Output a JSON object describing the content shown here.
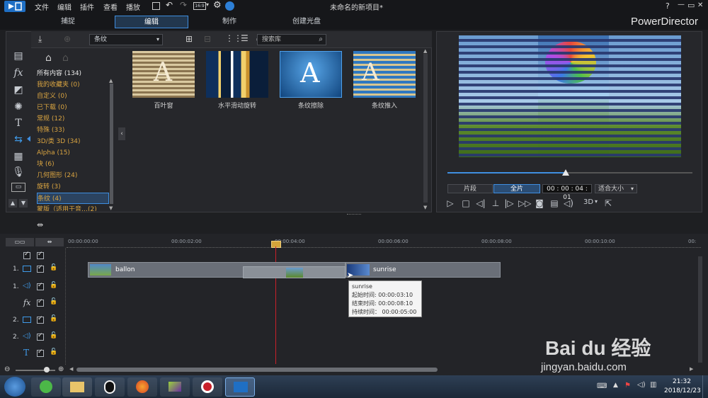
{
  "titlebar": {
    "menu": [
      "文件",
      "编辑",
      "插件",
      "查看",
      "播放"
    ],
    "project_title": "未命名的新项目*",
    "help": "?",
    "minimize": "—",
    "maximize": "▭",
    "close": "✕"
  },
  "modes": {
    "tabs": [
      "捕捉",
      "编辑",
      "制作",
      "创建光盘"
    ],
    "active": "编辑",
    "brand": "PowerDirector"
  },
  "library": {
    "category_select": "条纹",
    "search_placeholder": "搜索库",
    "categories": [
      "所有内容 (134)",
      "我的收藏夹 (0)",
      "自定义 (0)",
      "已下载 (0)",
      "常规 (12)",
      "特殊 (33)",
      "3D/类 3D (34)",
      "Alpha (15)",
      "块 (6)",
      "几何图形 (24)",
      "旋转 (3)",
      "条纹 (4)",
      "蒙版（适用于音…(2)"
    ],
    "selected_category": "条纹 (4)",
    "transitions": [
      "百叶窗",
      "水平滑动旋转",
      "条纹擦除",
      "条纹推入"
    ]
  },
  "preview": {
    "clip_label": "片段",
    "full_label": "全片",
    "timecode": "00 : 00 : 04 : 01",
    "fit": "适合大小",
    "mode_3d": "3D"
  },
  "timeline": {
    "ruler": [
      "00:00:00:00",
      "00:00:02:00",
      "00:00:04:00",
      "00:00:06:00",
      "00:00:08:00",
      "00:00:10:00",
      "00:"
    ],
    "tracks": [
      {
        "num": "1.",
        "type": "video"
      },
      {
        "num": "1.",
        "type": "audio"
      },
      {
        "num": "",
        "type": "fx"
      },
      {
        "num": "2.",
        "type": "video"
      },
      {
        "num": "2.",
        "type": "audio"
      },
      {
        "num": "",
        "type": "title"
      }
    ],
    "clips": {
      "clip1": "ballon",
      "clip2": "sunrise"
    },
    "tooltip": {
      "title": "sunrise",
      "start": "起始时间: 00:00:03:10",
      "end": "结束时间: 00:00:08:10",
      "duration": "持续时间： 00:00:05:00"
    }
  },
  "taskbar": {
    "time": "21:32",
    "date": "2018/12/23"
  },
  "watermark": {
    "brand": "Bai du 经验",
    "url": "jingyan.baidu.com"
  },
  "colors": {
    "accent": "#3f8ee0",
    "category_text": "#d9a441",
    "playhead": "#c8202a"
  }
}
